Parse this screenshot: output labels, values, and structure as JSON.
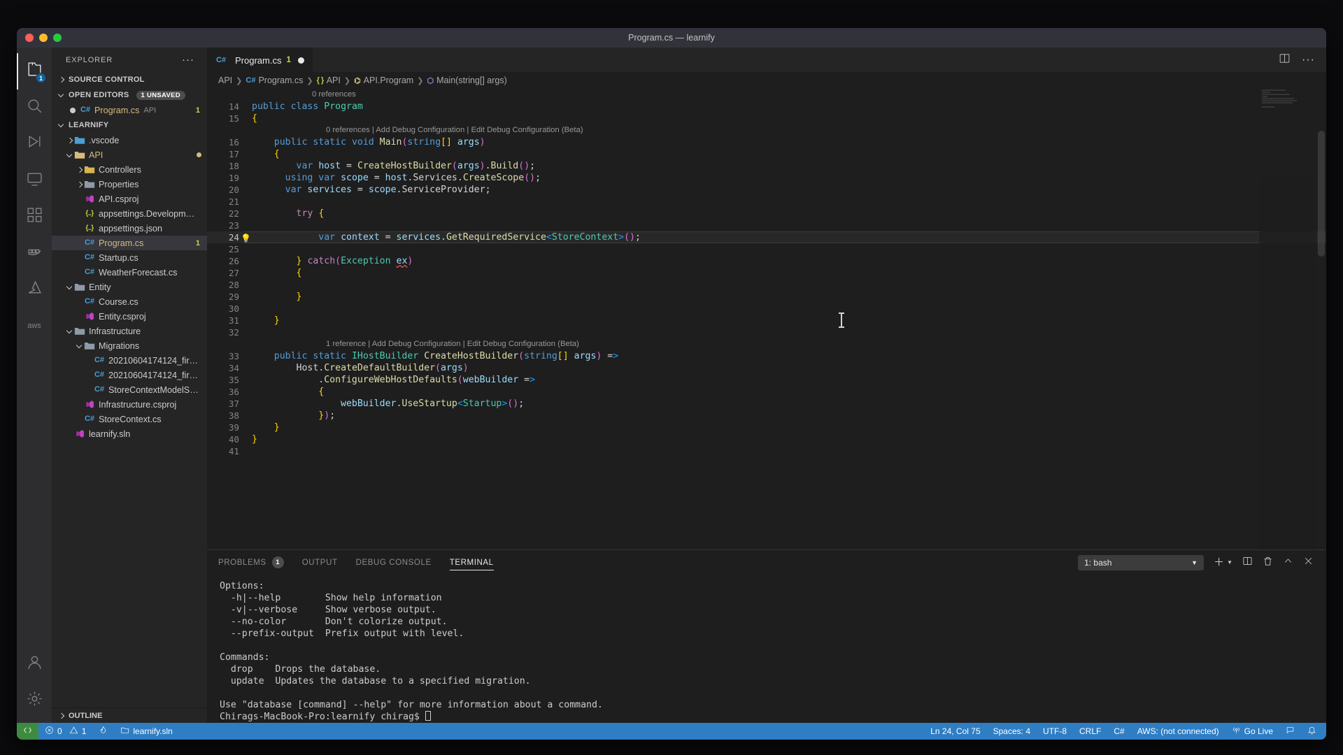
{
  "window": {
    "title": "Program.cs — learnify"
  },
  "activitybar": {
    "items": [
      {
        "name": "explorer",
        "icon": "files-icon",
        "badge": "1",
        "active": true
      },
      {
        "name": "search",
        "icon": "search-icon",
        "badge": "",
        "active": false
      },
      {
        "name": "run-and-debug",
        "icon": "debug-icon",
        "badge": "",
        "active": false
      },
      {
        "name": "remote-explorer",
        "icon": "remote-icon",
        "badge": "",
        "active": false
      },
      {
        "name": "extensions",
        "icon": "extensions-icon",
        "badge": "",
        "active": false
      },
      {
        "name": "docker",
        "icon": "docker-icon",
        "badge": "",
        "active": false
      },
      {
        "name": "azure",
        "icon": "azure-icon",
        "badge": "",
        "active": false
      },
      {
        "name": "aws",
        "icon": "aws-icon",
        "badge": "",
        "active": false
      }
    ],
    "bottom": [
      {
        "name": "accounts",
        "icon": "account-icon"
      },
      {
        "name": "settings",
        "icon": "gear-icon"
      }
    ]
  },
  "sidebar": {
    "title": "EXPLORER",
    "more_actions": "···",
    "sections": [
      {
        "label": "SOURCE CONTROL",
        "expanded": false,
        "badge": ""
      },
      {
        "label": "OPEN EDITORS",
        "expanded": true,
        "badge": "1 UNSAVED"
      },
      {
        "label": "LEARNIFY",
        "expanded": true,
        "badge": ""
      }
    ],
    "open_editors": [
      {
        "name": "Program.cs",
        "folder": "API",
        "icon": "csharp-icon",
        "dirty": true,
        "count": "1",
        "selected": false
      }
    ],
    "tree": [
      {
        "label": ".vscode",
        "icon": "folder-vscode-icon",
        "depth": 1,
        "type": "folder",
        "expanded": false
      },
      {
        "label": "API",
        "icon": "folder-api-icon",
        "depth": 1,
        "type": "folder",
        "expanded": true,
        "modified": true
      },
      {
        "label": "Controllers",
        "icon": "folder-gear-icon",
        "depth": 2,
        "type": "folder",
        "expanded": false
      },
      {
        "label": "Properties",
        "icon": "folder-icon",
        "depth": 2,
        "type": "folder",
        "expanded": false
      },
      {
        "label": "API.csproj",
        "icon": "csproj-icon",
        "depth": 2,
        "type": "file"
      },
      {
        "label": "appsettings.Developm…",
        "icon": "json-icon",
        "depth": 2,
        "type": "file"
      },
      {
        "label": "appsettings.json",
        "icon": "json-icon",
        "depth": 2,
        "type": "file"
      },
      {
        "label": "Program.cs",
        "icon": "csharp-icon",
        "depth": 2,
        "type": "file",
        "selected": true,
        "modified": true,
        "count": "1"
      },
      {
        "label": "Startup.cs",
        "icon": "csharp-icon",
        "depth": 2,
        "type": "file"
      },
      {
        "label": "WeatherForecast.cs",
        "icon": "csharp-icon",
        "depth": 2,
        "type": "file"
      },
      {
        "label": "Entity",
        "icon": "folder-icon",
        "depth": 1,
        "type": "folder",
        "expanded": true
      },
      {
        "label": "Course.cs",
        "icon": "csharp-icon",
        "depth": 2,
        "type": "file"
      },
      {
        "label": "Entity.csproj",
        "icon": "csproj-icon",
        "depth": 2,
        "type": "file"
      },
      {
        "label": "Infrastructure",
        "icon": "folder-icon",
        "depth": 1,
        "type": "folder",
        "expanded": true
      },
      {
        "label": "Migrations",
        "icon": "folder-icon",
        "depth": 2,
        "type": "folder",
        "expanded": true
      },
      {
        "label": "20210604174124_fir…",
        "icon": "csharp-icon",
        "depth": 3,
        "type": "file"
      },
      {
        "label": "20210604174124_fir…",
        "icon": "csharp-icon",
        "depth": 3,
        "type": "file"
      },
      {
        "label": "StoreContextModelS…",
        "icon": "csharp-icon",
        "depth": 3,
        "type": "file"
      },
      {
        "label": "Infrastructure.csproj",
        "icon": "csproj-icon",
        "depth": 2,
        "type": "file"
      },
      {
        "label": "StoreContext.cs",
        "icon": "csharp-icon",
        "depth": 2,
        "type": "file"
      },
      {
        "label": "learnify.sln",
        "icon": "sln-icon",
        "depth": 1,
        "type": "file"
      }
    ],
    "footer_section": {
      "label": "OUTLINE",
      "expanded": false
    }
  },
  "editor": {
    "tab": {
      "icon": "csharp-icon",
      "name": "Program.cs",
      "count": "1",
      "dirty": true
    },
    "tab_actions": [
      {
        "name": "split-editor-icon"
      },
      {
        "name": "more-actions-icon",
        "glyph": "···"
      }
    ],
    "breadcrumb": [
      {
        "label": "API",
        "icon": ""
      },
      {
        "label": "Program.cs",
        "icon": "C#"
      },
      {
        "label": "API",
        "icon": "{ }"
      },
      {
        "label": "API.Program",
        "icon": "class"
      },
      {
        "label": "Main(string[] args)",
        "icon": "method"
      }
    ],
    "first_visible_line": 13,
    "lines": [
      {
        "n": 14,
        "lens": "0 references"
      },
      {
        "n": 15
      },
      {
        "n": 16,
        "lens": "0 references | Add Debug Configuration | Edit Debug Configuration (Beta)"
      },
      {
        "n": 17
      },
      {
        "n": 18
      },
      {
        "n": 19
      },
      {
        "n": 20
      },
      {
        "n": 21
      },
      {
        "n": 22
      },
      {
        "n": 23
      },
      {
        "n": 24,
        "current": true,
        "bulb": "💡"
      },
      {
        "n": 25
      },
      {
        "n": 26
      },
      {
        "n": 27
      },
      {
        "n": 28
      },
      {
        "n": 29
      },
      {
        "n": 30
      },
      {
        "n": 31
      },
      {
        "n": 32
      },
      {
        "n": 33,
        "lens": "1 reference | Add Debug Configuration | Edit Debug Configuration (Beta)"
      },
      {
        "n": 34
      },
      {
        "n": 35
      },
      {
        "n": 36
      },
      {
        "n": 37
      },
      {
        "n": 38
      },
      {
        "n": 39
      },
      {
        "n": 40
      },
      {
        "n": 41
      }
    ],
    "source_text": [
      "public class Program",
      "{",
      "    public static void Main(string[] args)",
      "    {",
      "        var host = CreateHostBuilder(args).Build();",
      "      using var scope = host.Services.CreateScope();",
      "      var services = scope.ServiceProvider;",
      "",
      "        try {",
      "",
      "            var context = services.GetRequiredService<StoreContext>();",
      "",
      "        } catch(Exception ex)",
      "        {",
      "",
      "        }",
      "",
      "    }",
      "",
      "    public static IHostBuilder CreateHostBuilder(string[] args) =>",
      "        Host.CreateDefaultBuilder(args)",
      "            .ConfigureWebHostDefaults(webBuilder =>",
      "            {",
      "                webBuilder.UseStartup<Startup>();",
      "            });",
      "    }",
      "}",
      ""
    ]
  },
  "panel": {
    "tabs": [
      {
        "label": "PROBLEMS",
        "badge": "1",
        "active": false
      },
      {
        "label": "OUTPUT",
        "badge": "",
        "active": false
      },
      {
        "label": "DEBUG CONSOLE",
        "badge": "",
        "active": false
      },
      {
        "label": "TERMINAL",
        "badge": "",
        "active": true
      }
    ],
    "terminal_select": {
      "value": "1: bash",
      "chevron": "chevron-down-icon"
    },
    "actions": [
      {
        "name": "new-terminal-icon"
      },
      {
        "name": "split-terminal-icon"
      },
      {
        "name": "kill-terminal-icon"
      },
      {
        "name": "maximize-panel-icon"
      },
      {
        "name": "close-panel-icon"
      }
    ],
    "terminal_output": "Options:\n  -h|--help        Show help information\n  -v|--verbose     Show verbose output.\n  --no-color       Don't colorize output.\n  --prefix-output  Prefix output with level.\n\nCommands:\n  drop    Drops the database.\n  update  Updates the database to a specified migration.\n\nUse \"database [command] --help\" for more information about a command.",
    "terminal_prompt": "Chirags-MacBook-Pro:learnify chirag$ "
  },
  "statusbar": {
    "remote_icon": "remote-indicator-icon",
    "left": [
      {
        "name": "problems",
        "icon": "errors-warnings-icon",
        "label": "0  1"
      },
      {
        "name": "live-share",
        "icon": "flame-icon",
        "label": ""
      },
      {
        "name": "solution",
        "icon": "solution-icon",
        "label": "learnify.sln"
      }
    ],
    "errors": "0",
    "warnings": "1",
    "solution_file": "learnify.sln",
    "right": [
      {
        "name": "cursor-position",
        "label": "Ln 24, Col 75"
      },
      {
        "name": "indentation",
        "label": "Spaces: 4"
      },
      {
        "name": "encoding",
        "label": "UTF-8"
      },
      {
        "name": "eol",
        "label": "CRLF"
      },
      {
        "name": "language-mode",
        "label": "C#"
      },
      {
        "name": "aws-connection",
        "label": "AWS: (not connected)"
      },
      {
        "name": "go-live",
        "label": "Go Live",
        "icon": "broadcast-icon"
      },
      {
        "name": "feedback",
        "label": "",
        "icon": "feedback-icon"
      },
      {
        "name": "notifications",
        "label": "",
        "icon": "bell-icon"
      }
    ]
  }
}
